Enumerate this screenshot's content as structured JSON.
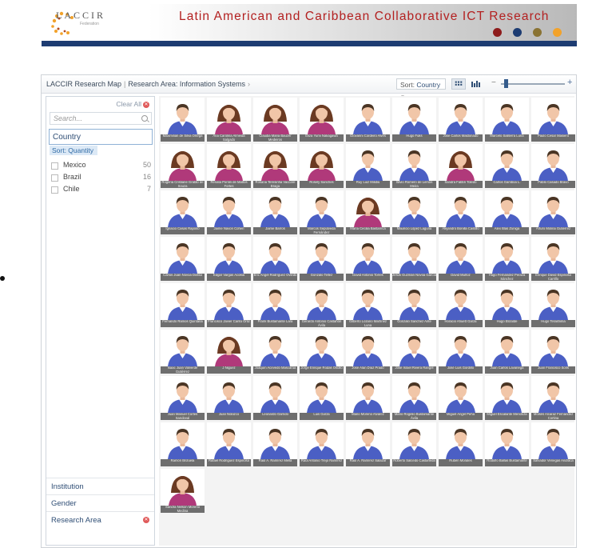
{
  "banner": {
    "logo_text": "LACCIR",
    "logo_sub": "Federation",
    "title": "Latin American and Caribbean Collaborative ICT Research",
    "dot_colors": [
      "#8e1c1c",
      "#1d3c72",
      "#8a7333",
      "#f2a22a"
    ]
  },
  "toolbar": {
    "breadcrumb": [
      "LACCIR Research Map",
      "Research Area: Information Systems"
    ],
    "breadcrumb_sep": "|",
    "breadcrumb_arrow": "›",
    "sort_label": "Sort:",
    "sort_value": "Country",
    "zoom_minus": "−",
    "zoom_plus": "+",
    "zoom_level": 0.05
  },
  "filter_panel": {
    "clear_all": "Clear All",
    "search_placeholder": "Search...",
    "country": {
      "title": "Country",
      "sort_label": "Sort: Quantity",
      "items": [
        {
          "name": "Mexico",
          "count": "50"
        },
        {
          "name": "Brazil",
          "count": "16"
        },
        {
          "name": "Chile",
          "count": "7"
        }
      ]
    },
    "sections": [
      "Institution",
      "Gender",
      "Research Area"
    ]
  },
  "colors": {
    "accent": "#2f4e75",
    "banner_bar": "#1d3c72",
    "male_shirt": "#4b5fc4",
    "female_top": "#b0397a"
  },
  "researchers": [
    {
      "name": "Maximilian de Silva Ortega",
      "gender": "m"
    },
    {
      "name": "Ana Carolina Almeida Salgado",
      "gender": "f"
    },
    {
      "name": "Claudia Maria Bauzer Medeiros",
      "gender": "f"
    },
    {
      "name": "Eliza Yumi Nakagawa",
      "gender": "f"
    },
    {
      "name": "Giovanni Cordeiro Alves",
      "gender": "m"
    },
    {
      "name": "Hugo Fuks",
      "gender": "m"
    },
    {
      "name": "Jose Carlos Maldonado",
      "gender": "m"
    },
    {
      "name": "Marcelo Saliterra Luna",
      "gender": "m"
    },
    {
      "name": "Paulo Cesar Masiero",
      "gender": "m"
    },
    {
      "name": "Rogeria Cristiane Gratão de Souza",
      "gender": "f"
    },
    {
      "name": "Renata Pontin de Mattos Fortes",
      "gender": "f"
    },
    {
      "name": "Rosana Teresinha Vaccare Braga",
      "gender": "f"
    },
    {
      "name": "Rosely Sanches",
      "gender": "f"
    },
    {
      "name": "Ruy Luiz Milidiú",
      "gender": "m"
    },
    {
      "name": "Silvio Romero de Lemos Meira",
      "gender": "m"
    },
    {
      "name": "Sandra Fabbri Toledo",
      "gender": "f"
    },
    {
      "name": "Carlos Gamboa L.",
      "gender": "m"
    },
    {
      "name": "Pablo Casado Bravo",
      "gender": "m"
    },
    {
      "name": "Ignacio Casas Raposo",
      "gender": "m"
    },
    {
      "name": "Jaime Navon Cohen",
      "gender": "m"
    },
    {
      "name": "Jaime Barros",
      "gender": "m"
    },
    {
      "name": "Marcos Sepúlveda Fernández",
      "gender": "m"
    },
    {
      "name": "María Cecilia Bastarrica",
      "gender": "f"
    },
    {
      "name": "Mauricio López Laguna",
      "gender": "m"
    },
    {
      "name": "Alejandro Bonilla Castillo",
      "gender": "m"
    },
    {
      "name": "Alex Blas Zuniga",
      "gender": "m"
    },
    {
      "name": "Arturo Molina Gutiérrez",
      "gender": "m"
    },
    {
      "name": "Carlos Juan Novoa Dossa",
      "gender": "m"
    },
    {
      "name": "Edgar Vargas Acosta",
      "gender": "m"
    },
    {
      "name": "Eric Angel Rodríguez Oviedo",
      "gender": "m"
    },
    {
      "name": "Gonzalo Tellez",
      "gender": "m"
    },
    {
      "name": "David Antonio Torres",
      "gender": "m"
    },
    {
      "name": "Jesús Guzmán Novoa García",
      "gender": "m"
    },
    {
      "name": "David Muñoz",
      "gender": "m"
    },
    {
      "name": "Hugo Fernández Peraza Sánchez",
      "gender": "m"
    },
    {
      "name": "Enrique David Espinosa Carrillo",
      "gender": "m"
    },
    {
      "name": "Fernando Ramos Quintana",
      "gender": "m"
    },
    {
      "name": "Francisco Javier Cantú Ortiz",
      "gender": "m"
    },
    {
      "name": "Frank Bustamante Lara",
      "gender": "m"
    },
    {
      "name": "Gerardo Antonio Castañón Ávila",
      "gender": "m"
    },
    {
      "name": "Gilberto Lozano Martínez Luna",
      "gender": "m"
    },
    {
      "name": "Gonzalo Sanchez Ante",
      "gender": "m"
    },
    {
      "name": "Horacio Ahuett Garza",
      "gender": "m"
    },
    {
      "name": "Hugo Elizalde",
      "gender": "m"
    },
    {
      "name": "Hugo Terashima",
      "gender": "m"
    },
    {
      "name": "Isaac Juan Valverde Gutiérrez",
      "gender": "m"
    },
    {
      "name": "J Niguez",
      "gender": "f"
    },
    {
      "name": "Joaquín Acevedo Mascarúa",
      "gender": "m"
    },
    {
      "name": "Jorge Enrique Rodas Osollo",
      "gender": "m"
    },
    {
      "name": "José Alan Díaz Prado",
      "gender": "m"
    },
    {
      "name": "José Israel Rivera Rangel",
      "gender": "m"
    },
    {
      "name": "José Luis Gordillo",
      "gender": "m"
    },
    {
      "name": "Juan Carlos Lavariega",
      "gender": "m"
    },
    {
      "name": "Juan Francisco Solís",
      "gender": "m"
    },
    {
      "name": "Juan Manuel Cortes Sandoval",
      "gender": "m"
    },
    {
      "name": "Juan Nolazco",
      "gender": "m"
    },
    {
      "name": "Leonardo Garrido",
      "gender": "m"
    },
    {
      "name": "Luis Garza",
      "gender": "m"
    },
    {
      "name": "Mario Moreno Alvarez",
      "gender": "m"
    },
    {
      "name": "Mario Rogelio Bustamante Ávila",
      "gender": "m"
    },
    {
      "name": "Miguel Angel Peña",
      "gender": "m"
    },
    {
      "name": "Miguel Escalante Mendoza",
      "gender": "m"
    },
    {
      "name": "Moisés Alcaraz Fernández Cortina",
      "gender": "m"
    },
    {
      "name": "Ramón Brizuela",
      "gender": "m"
    },
    {
      "name": "Rafael Rodríguez Espinosa",
      "gender": "m"
    },
    {
      "name": "Raúl A. Ramírez Mella",
      "gender": "m"
    },
    {
      "name": "Raúl Antonio Trejo Ramírez",
      "gender": "m"
    },
    {
      "name": "Raúl A. Ramírez Salazar",
      "gender": "m"
    },
    {
      "name": "Roberto Salcedo Castañeda",
      "gender": "m"
    },
    {
      "name": "Rubén Morales",
      "gender": "m"
    },
    {
      "name": "Rodolfo Ballas Bustamante",
      "gender": "m"
    },
    {
      "name": "Salvador Venegas Andraca",
      "gender": "m"
    },
    {
      "name": "Sandra Nelson Moreno Medina",
      "gender": "f"
    }
  ]
}
